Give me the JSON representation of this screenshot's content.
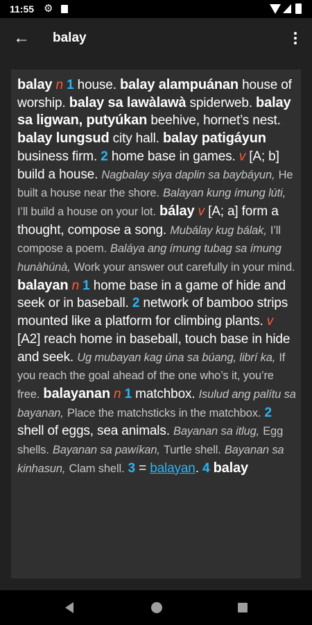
{
  "status_bar": {
    "time": "11:55"
  },
  "app_bar": {
    "title": "balay"
  },
  "entry": [
    {
      "type": "hw",
      "text": "balay"
    },
    {
      "type": "pos",
      "text": "n"
    },
    {
      "type": "num",
      "text": "1"
    },
    {
      "type": "def",
      "text": "house."
    },
    {
      "type": "hw",
      "text": "balay alampuánan"
    },
    {
      "type": "def",
      "text": "house of worship."
    },
    {
      "type": "hw",
      "text": "balay sa lawàlawà"
    },
    {
      "type": "def",
      "text": "spiderweb."
    },
    {
      "type": "hw",
      "text": "balay sa ligwan, putyúkan"
    },
    {
      "type": "def",
      "text": "beehive, hornet’s nest."
    },
    {
      "type": "hw",
      "text": "balay lungsud"
    },
    {
      "type": "def",
      "text": "city hall."
    },
    {
      "type": "hw",
      "text": "balay patigáyun"
    },
    {
      "type": "def",
      "text": "business firm."
    },
    {
      "type": "num",
      "text": "2"
    },
    {
      "type": "def",
      "text": "home base in games."
    },
    {
      "type": "pos",
      "text": "v"
    },
    {
      "type": "def",
      "text": "[A; b] build a house."
    },
    {
      "type": "ex",
      "text": "Nagbalay siya daplin sa baybáyun,"
    },
    {
      "type": "tr",
      "text": "He built a house near the shore."
    },
    {
      "type": "ex",
      "text": "Balayan kung ímung lúti,"
    },
    {
      "type": "tr",
      "text": "I’ll build a house on your lot."
    },
    {
      "type": "hw",
      "text": "bálay"
    },
    {
      "type": "pos",
      "text": "v"
    },
    {
      "type": "def",
      "text": "[A; a] form a thought, compose a song."
    },
    {
      "type": "ex",
      "text": "Mubálay kug bálak,"
    },
    {
      "type": "tr",
      "text": "I’ll compose a poem."
    },
    {
      "type": "ex",
      "text": "Baláya ang ímung tubag sa ímung hunàhúnà,"
    },
    {
      "type": "tr",
      "text": "Work your answer out carefully in your mind."
    },
    {
      "type": "hw",
      "text": "balayan"
    },
    {
      "type": "pos",
      "text": "n"
    },
    {
      "type": "num",
      "text": "1"
    },
    {
      "type": "def",
      "text": "home base in a game of hide and seek or in baseball."
    },
    {
      "type": "num",
      "text": "2"
    },
    {
      "type": "def",
      "text": "network of bamboo strips mounted like a platform for climbing plants."
    },
    {
      "type": "pos",
      "text": "v"
    },
    {
      "type": "def",
      "text": "[A2] reach home in baseball, touch base in hide and seek."
    },
    {
      "type": "ex",
      "text": "Ug mubayan kag úna sa búang, librí ka,"
    },
    {
      "type": "tr",
      "text": "If you reach the goal ahead of the one who’s it, you’re free."
    },
    {
      "type": "hw",
      "text": "balayanan"
    },
    {
      "type": "pos",
      "text": "n"
    },
    {
      "type": "num",
      "text": "1"
    },
    {
      "type": "def",
      "text": "matchbox."
    },
    {
      "type": "ex",
      "text": "Isulud ang palítu sa bayanan,"
    },
    {
      "type": "tr",
      "text": "Place the matchsticks in the matchbox."
    },
    {
      "type": "num",
      "text": "2"
    },
    {
      "type": "def",
      "text": "shell of eggs, sea animals."
    },
    {
      "type": "ex",
      "text": "Bayanan sa itlug,"
    },
    {
      "type": "tr",
      "text": "Egg shells."
    },
    {
      "type": "ex",
      "text": "Bayanan sa pawíkan,"
    },
    {
      "type": "tr",
      "text": "Turtle shell."
    },
    {
      "type": "ex",
      "text": "Bayanan sa kinhasun,"
    },
    {
      "type": "tr",
      "text": "Clam shell."
    },
    {
      "type": "num",
      "text": "3"
    },
    {
      "type": "def",
      "text": "="
    },
    {
      "type": "link",
      "text": "balayan"
    },
    {
      "type": "def",
      "text": "."
    },
    {
      "type": "num",
      "text": "4"
    },
    {
      "type": "hw",
      "text": "balay"
    }
  ],
  "colors": {
    "background": "#212121",
    "panel": "#303030",
    "part_of_speech": "#ff5a3c",
    "sense_number": "#2eb4f0",
    "example": "#c6c6c6"
  },
  "icons": {
    "back": "arrow-left-icon",
    "more": "more-vert-icon",
    "settings": "gear-icon",
    "sd": "sd-card-icon",
    "wifi": "wifi-icon",
    "signal": "signal-icon",
    "battery": "battery-icon"
  }
}
